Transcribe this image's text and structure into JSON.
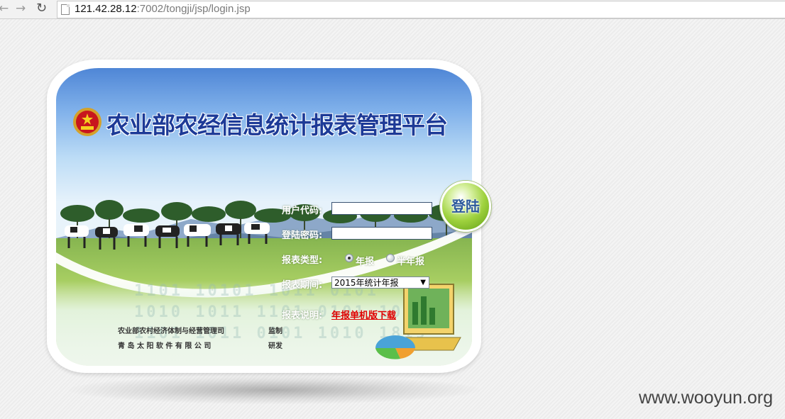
{
  "browser": {
    "url_host": "121.42.28.12",
    "url_rest": ":7002/tongji/jsp/login.jsp"
  },
  "page": {
    "title": "农业部农经信息统计报表管理平台",
    "binary_bg": "1101 10101 1011 0101 1010 1011 1101 0101 1010 1101 1011 0101 1010 1819"
  },
  "form": {
    "user_code_label": "用户代码:",
    "user_code_value": "",
    "password_label": "登陆密码:",
    "password_value": "",
    "report_type_label": "报表类型:",
    "report_type_options": [
      "年报",
      "半年报"
    ],
    "report_type_selected": "年报",
    "period_label": "报表期间:",
    "period_selected": "2015年统计年报",
    "desc_label": "报表说明:",
    "download_link": "年报单机版下载",
    "login_button": "登陆"
  },
  "credits": {
    "line1_org": "农业部农村经济体制与经营管理司",
    "line1_role": "监制",
    "line2_org": "青 岛 太 阳 软 件 有 限 公 司",
    "line2_role": "研发"
  },
  "watermark": "www.wooyun.org",
  "colors": {
    "title": "#1d3a97",
    "link": "#e00000",
    "button": "#9fd23e"
  }
}
